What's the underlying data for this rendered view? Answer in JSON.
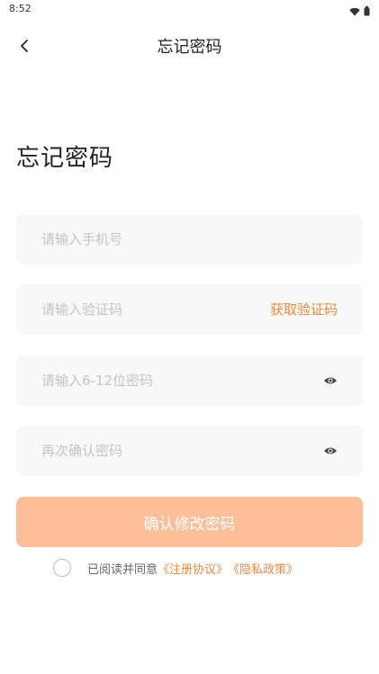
{
  "status_bar": {
    "time": "8:52"
  },
  "nav": {
    "title": "忘记密码"
  },
  "heading": "忘记密码",
  "form": {
    "phone_placeholder": "请输入手机号",
    "code_placeholder": "请输入验证码",
    "get_code_label": "获取验证码",
    "password_placeholder": "请输入6-12位密码",
    "confirm_placeholder": "再次确认密码",
    "submit_label": "确认修改密码"
  },
  "agreement": {
    "prefix": "已阅读并同意",
    "terms_link": "《注册协议》",
    "privacy_link": "《隐私政策》"
  },
  "colors": {
    "accent": "#f08a3e",
    "button_bg": "#fdbf98",
    "field_bg": "#f8f8f8"
  }
}
